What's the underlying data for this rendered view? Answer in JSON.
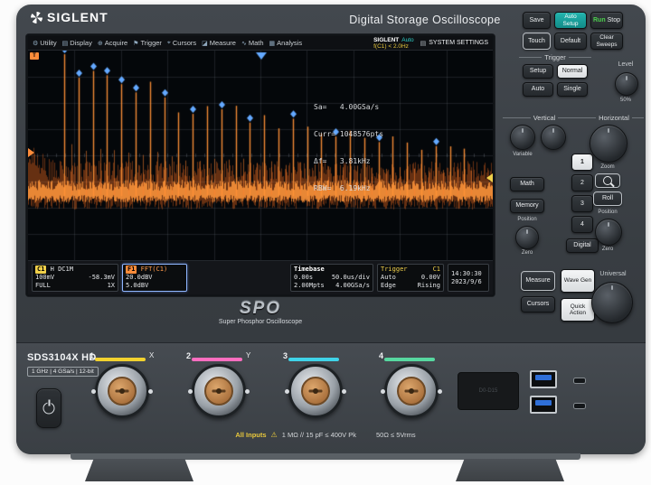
{
  "colors": {
    "trace": "#ff7c2a",
    "marker": "#64a9ff",
    "accent_teal": "#17a2a2",
    "run_green": "#4cd04c",
    "warn_yellow": "#e8c83c"
  },
  "header": {
    "brand": "SIGLENT",
    "title": "Digital Storage Oscilloscope"
  },
  "screen": {
    "menu": [
      {
        "glyph": "⚙",
        "label": "Utility"
      },
      {
        "glyph": "▤",
        "label": "Display"
      },
      {
        "glyph": "⊕",
        "label": "Acquire"
      },
      {
        "glyph": "⚑",
        "label": "Trigger"
      },
      {
        "glyph": "⌖",
        "label": "Cursors"
      },
      {
        "glyph": "◪",
        "label": "Measure"
      },
      {
        "glyph": "∿",
        "label": "Math"
      },
      {
        "glyph": "▦",
        "label": "Analysis"
      }
    ],
    "brand_small": "SIGLENT",
    "acq_status": "Auto",
    "trigger_freq": "f(C1) < 2.0Hz",
    "system_settings": "SYSTEM SETTINGS",
    "readout": {
      "sa": "Sa=   4.00GSa/s",
      "curr": "Curr= 1048576pts",
      "delta_f": "Δf=   3.81kHz",
      "rbw": "RBW=  6.19kHz"
    },
    "status": {
      "c1": {
        "label": "C1",
        "coupling": "H DC1M",
        "scale": "100mV",
        "offset": "-58.3mV",
        "bw": "FULL",
        "probe": "1X"
      },
      "f1": {
        "label": "F1",
        "source": "FFT(C1)",
        "scale": "20.0dBV",
        "offset": "5.0dBV"
      },
      "timebase": {
        "title": "Timebase",
        "delay": "0.00s",
        "scale": "50.0us/div",
        "points": "2.00Mpts",
        "rate": "4.00GSa/s"
      },
      "trigger": {
        "title": "Trigger",
        "source": "C1",
        "mode": "Auto",
        "level": "0.00V",
        "type": "Edge",
        "slope": "Rising"
      },
      "clock": {
        "time": "14:30:30",
        "date": "2023/9/6"
      }
    },
    "logo": "SPO",
    "logo_sub": "Super Phosphor Oscilloscope"
  },
  "controls": {
    "save": "Save",
    "auto_setup": "Auto Setup",
    "run": "Run",
    "stop": "Stop",
    "touch": "Touch",
    "default": "Default",
    "clear_sweeps": "Clear Sweeps",
    "trigger_title": "Trigger",
    "setup": "Setup",
    "normal": "Normal",
    "auto": "Auto",
    "single": "Single",
    "level": "Level",
    "level_pct": "50%",
    "vertical_title": "Vertical",
    "variable": "Variable",
    "ch": [
      "1",
      "2",
      "3",
      "4"
    ],
    "math": "Math",
    "memory": "Memory",
    "position": "Position",
    "zero": "Zero",
    "digital": "Digital",
    "horizontal_title": "Horizontal",
    "zoom": "Zoom",
    "roll": "Roll",
    "measure": "Measure",
    "wave_gen": "Wave Gen",
    "cursors": "Cursors",
    "quick_action": "Quick Action",
    "universal_title": "Universal"
  },
  "front": {
    "model": "SDS3104X HD",
    "specs": "1 GHz | 4 GSa/s | 12-bit",
    "channels": [
      {
        "num": "1",
        "aux": "X",
        "color": "#f2d22e"
      },
      {
        "num": "2",
        "aux": "Y",
        "color": "#ff6ec0"
      },
      {
        "num": "3",
        "aux": "",
        "color": "#3fd3e8"
      },
      {
        "num": "4",
        "aux": "",
        "color": "#57d8a0"
      }
    ],
    "digital_label": "D0-D15",
    "warn_inputs": "All Inputs",
    "warn_icon": "⚠",
    "warn_spec": "1 MΩ // 15 pF ≤ 400V Pk",
    "warn_spec2": "50Ω ≤ 5Vrms"
  }
}
